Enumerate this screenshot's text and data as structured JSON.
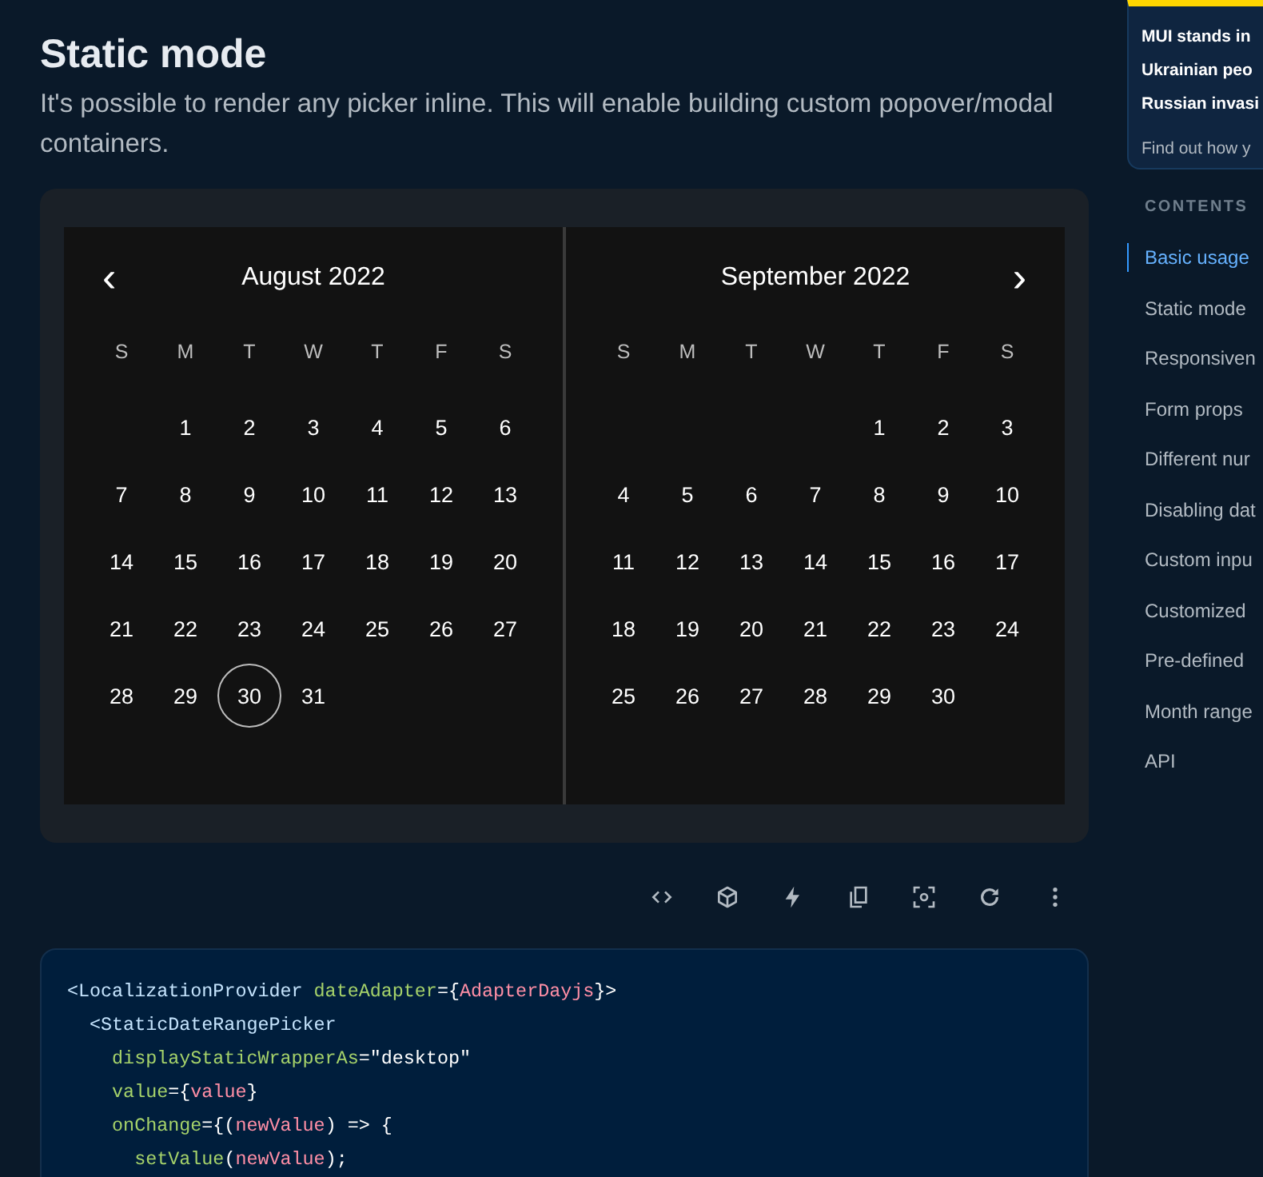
{
  "section": {
    "title": "Static mode",
    "description": "It's possible to render any picker inline. This will enable building custom popover/modal containers."
  },
  "calendar": {
    "prev_icon": "‹",
    "next_icon": "›",
    "months": [
      {
        "title": "August 2022",
        "weekdays": [
          "S",
          "M",
          "T",
          "W",
          "T",
          "F",
          "S"
        ],
        "weeks": [
          [
            {
              "day": "1",
              "today": false
            },
            {
              "day": "2",
              "today": false
            },
            {
              "day": "3",
              "today": false
            },
            {
              "day": "4",
              "today": false
            },
            {
              "day": "5",
              "today": false
            },
            {
              "day": "6",
              "today": false
            }
          ],
          [
            {
              "day": "7",
              "today": false
            },
            {
              "day": "8",
              "today": false
            },
            {
              "day": "9",
              "today": false
            },
            {
              "day": "10",
              "today": false
            },
            {
              "day": "11",
              "today": false
            },
            {
              "day": "12",
              "today": false
            },
            {
              "day": "13",
              "today": false
            }
          ],
          [
            {
              "day": "14",
              "today": false
            },
            {
              "day": "15",
              "today": false
            },
            {
              "day": "16",
              "today": false
            },
            {
              "day": "17",
              "today": false
            },
            {
              "day": "18",
              "today": false
            },
            {
              "day": "19",
              "today": false
            },
            {
              "day": "20",
              "today": false
            }
          ],
          [
            {
              "day": "21",
              "today": false
            },
            {
              "day": "22",
              "today": false
            },
            {
              "day": "23",
              "today": false
            },
            {
              "day": "24",
              "today": false
            },
            {
              "day": "25",
              "today": false
            },
            {
              "day": "26",
              "today": false
            },
            {
              "day": "27",
              "today": false
            }
          ],
          [
            {
              "day": "28",
              "today": false
            },
            {
              "day": "29",
              "today": false
            },
            {
              "day": "30",
              "today": true
            },
            {
              "day": "31",
              "today": false
            }
          ]
        ]
      },
      {
        "title": "September 2022",
        "weekdays": [
          "S",
          "M",
          "T",
          "W",
          "T",
          "F",
          "S"
        ],
        "weeks": [
          [
            {
              "day": "1",
              "today": false
            },
            {
              "day": "2",
              "today": false
            },
            {
              "day": "3",
              "today": false
            }
          ],
          [
            {
              "day": "4",
              "today": false
            },
            {
              "day": "5",
              "today": false
            },
            {
              "day": "6",
              "today": false
            },
            {
              "day": "7",
              "today": false
            },
            {
              "day": "8",
              "today": false
            },
            {
              "day": "9",
              "today": false
            },
            {
              "day": "10",
              "today": false
            }
          ],
          [
            {
              "day": "11",
              "today": false
            },
            {
              "day": "12",
              "today": false
            },
            {
              "day": "13",
              "today": false
            },
            {
              "day": "14",
              "today": false
            },
            {
              "day": "15",
              "today": false
            },
            {
              "day": "16",
              "today": false
            },
            {
              "day": "17",
              "today": false
            }
          ],
          [
            {
              "day": "18",
              "today": false
            },
            {
              "day": "19",
              "today": false
            },
            {
              "day": "20",
              "today": false
            },
            {
              "day": "21",
              "today": false
            },
            {
              "day": "22",
              "today": false
            },
            {
              "day": "23",
              "today": false
            },
            {
              "day": "24",
              "today": false
            }
          ],
          [
            {
              "day": "25",
              "today": false
            },
            {
              "day": "26",
              "today": false
            },
            {
              "day": "27",
              "today": false
            },
            {
              "day": "28",
              "today": false
            },
            {
              "day": "29",
              "today": false
            },
            {
              "day": "30",
              "today": false
            }
          ]
        ]
      }
    ]
  },
  "toolbar": [
    {
      "kind": "code"
    },
    {
      "kind": "box"
    },
    {
      "kind": "bolt"
    },
    {
      "kind": "copy"
    },
    {
      "kind": "focus"
    },
    {
      "kind": "reset"
    },
    {
      "kind": "more"
    }
  ],
  "code": [
    {
      "tokens": [
        {
          "kind": "tag",
          "text": "<LocalizationProvider"
        },
        {
          "kind": "attr",
          "text": "dateAdapter"
        },
        {
          "kind": "plain",
          "text": "={"
        },
        {
          "kind": "var",
          "text": "AdapterDayjs"
        },
        {
          "kind": "plain",
          "text": "}>"
        }
      ],
      "children": [
        {
          "tokens": [
            {
              "kind": "tag",
              "text": "<StaticDateRangePicker"
            }
          ],
          "children": [
            {
              "tokens": [
                {
                  "kind": "attr",
                  "text": "displayStaticWrapperAs"
                },
                {
                  "kind": "plain",
                  "text": "=\"desktop\""
                }
              ]
            },
            {
              "tokens": [
                {
                  "kind": "attr",
                  "text": "value"
                },
                {
                  "kind": "plain",
                  "text": "={"
                },
                {
                  "kind": "var",
                  "text": "value"
                },
                {
                  "kind": "plain",
                  "text": "}"
                }
              ]
            },
            {
              "tokens": [
                {
                  "kind": "attr",
                  "text": "onChange"
                },
                {
                  "kind": "plain",
                  "text": "={("
                },
                {
                  "kind": "var",
                  "text": "newValue"
                },
                {
                  "kind": "plain",
                  "text": ") => {"
                }
              ],
              "children": [
                {
                  "tokens": [
                    {
                      "kind": "attr",
                      "text": "setValue"
                    },
                    {
                      "kind": "plain",
                      "text": "("
                    },
                    {
                      "kind": "var",
                      "text": "newValue"
                    },
                    {
                      "kind": "plain",
                      "text": ");"
                    }
                  ]
                }
              ]
            }
          ]
        }
      ]
    }
  ],
  "banner": {
    "lines": [
      "MUI stands in",
      "Ukrainian peo",
      "Russian invasi"
    ],
    "link": "Find out how y"
  },
  "contents": {
    "heading": "CONTENTS",
    "items": [
      {
        "label": "Basic usage",
        "selected": true
      },
      {
        "label": "Static mode",
        "selected": false
      },
      {
        "label": "Responsiven",
        "selected": false
      },
      {
        "label": "Form props",
        "selected": false
      },
      {
        "label": "Different nur",
        "selected": false
      },
      {
        "label": "Disabling dat",
        "selected": false
      },
      {
        "label": "Custom inpu",
        "selected": false
      },
      {
        "label": "Customized",
        "selected": false
      },
      {
        "label": "Pre-defined",
        "selected": false
      },
      {
        "label": "Month range",
        "selected": false
      },
      {
        "label": "API",
        "selected": false
      }
    ]
  }
}
